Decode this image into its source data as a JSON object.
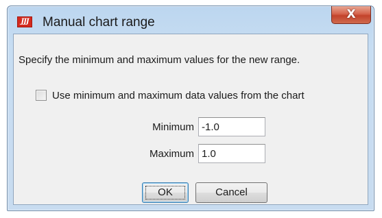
{
  "window": {
    "title": "Manual chart range",
    "app_icon_text": "JJJ",
    "close_glyph": "X"
  },
  "dialog": {
    "instructions": "Specify the minimum and maximum values for the new range.",
    "use_data_checkbox": {
      "label": "Use minimum and maximum data values from the chart",
      "checked": false
    },
    "minimum": {
      "label": "Minimum",
      "value": "-1.0"
    },
    "maximum": {
      "label": "Maximum",
      "value": "1.0"
    },
    "ok_label": "OK",
    "cancel_label": "Cancel"
  },
  "colors": {
    "frame": "#c7ddf2",
    "close_button": "#c3432c",
    "content_bg": "#f0f0f0"
  }
}
